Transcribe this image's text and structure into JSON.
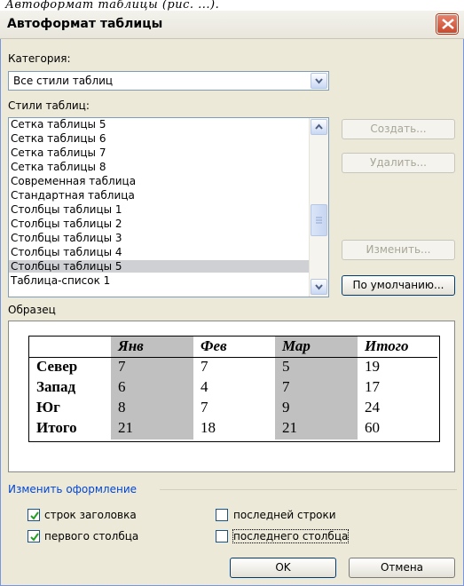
{
  "caption": "Автоформат таблицы (рис. ...).",
  "dialog": {
    "title": "Автоформат таблицы"
  },
  "category": {
    "label": "Категория:",
    "value": "Все стили таблиц"
  },
  "styles": {
    "label": "Стили таблиц:",
    "items": [
      "Сетка таблицы 5",
      "Сетка таблицы 6",
      "Сетка таблицы 7",
      "Сетка таблицы 8",
      "Современная таблица",
      "Стандартная таблица",
      "Столбцы таблицы 1",
      "Столбцы таблицы 2",
      "Столбцы таблицы 3",
      "Столбцы таблицы 4",
      "Столбцы таблицы 5",
      "Таблица-список 1"
    ],
    "selected_index": 10
  },
  "buttons": {
    "create": "Создать...",
    "delete": "Удалить...",
    "modify": "Изменить...",
    "default": "По умолчанию...",
    "ok": "OK",
    "cancel": "Отмена"
  },
  "preview": {
    "label": "Образец",
    "headers": [
      "",
      "Янв",
      "Фев",
      "Мар",
      "Итого"
    ],
    "rows": [
      [
        "Север",
        "7",
        "7",
        "5",
        "19"
      ],
      [
        "Запад",
        "6",
        "4",
        "7",
        "17"
      ],
      [
        "Юг",
        "8",
        "7",
        "9",
        "24"
      ],
      [
        "Итого",
        "21",
        "18",
        "21",
        "60"
      ]
    ]
  },
  "format": {
    "group_label": "Изменить оформление",
    "header_rows": {
      "label": "строк заголовка",
      "checked": true
    },
    "first_column": {
      "label": "первого столбца",
      "checked": true
    },
    "last_row": {
      "label": "последней строки",
      "checked": false
    },
    "last_column": {
      "label": "последнего столбца",
      "checked": false
    }
  },
  "colors": {
    "accent": "#003c74",
    "group_label": "#0046d5",
    "close": "#c94a2e"
  }
}
